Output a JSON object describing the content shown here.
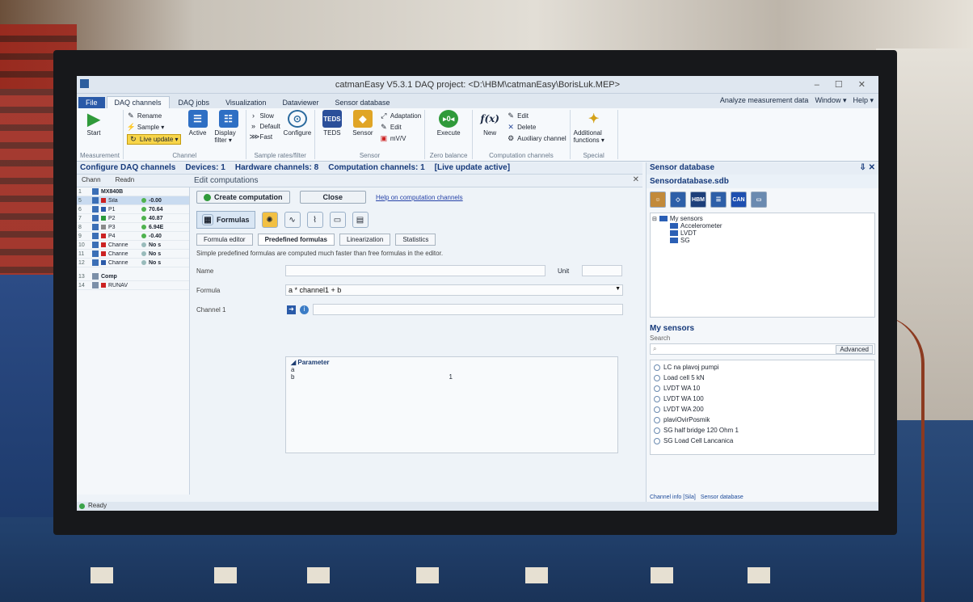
{
  "window": {
    "title": "catmanEasy V5.3.1 DAQ project: <D:\\HBM\\catmanEasy\\BorisLuk.MEP>",
    "controls": "– ☐ ✕"
  },
  "ribbon_tabs": [
    "File",
    "DAQ channels",
    "DAQ jobs",
    "Visualization",
    "Dataviewer",
    "Sensor database"
  ],
  "ribbon_right": {
    "analyze": "Analyze measurement data",
    "window": "Window ▾",
    "help": "Help ▾"
  },
  "ribbon": {
    "measurement": {
      "start": "Start",
      "label": "Measurement"
    },
    "channel": {
      "rename": "Rename",
      "sample": "Sample ▾",
      "live_update": "Live update ▾",
      "active": "Active",
      "display_filter": "Display filter ▾",
      "label": "Channel"
    },
    "sample_rates": {
      "slow": "Slow",
      "default": "Default",
      "fast": "Fast",
      "label": "Sample rates/filter"
    },
    "sensor": {
      "configure": "Configure",
      "teds": "TEDS",
      "sensor": "Sensor",
      "adaptation": "Adaptation",
      "edit": "Edit",
      "mvv": "mV/V",
      "label": "Sensor"
    },
    "zero": {
      "execute": "Execute",
      "label": "Zero balance"
    },
    "computation": {
      "new": "New",
      "edit": "Edit",
      "delete": "Delete",
      "auxiliary": "Auxiliary channel",
      "label": "Computation channels"
    },
    "special": {
      "additional": "Additional functions ▾",
      "label": "Special"
    }
  },
  "config_header": {
    "title": "Configure DAQ channels",
    "devices": "Devices: 1",
    "hardware": "Hardware channels: 8",
    "computation": "Computation channels: 1",
    "live": "[Live update active]"
  },
  "grid": {
    "headers": [
      "Chann",
      "Readn"
    ],
    "rows": [
      {
        "n": "1",
        "name": "MX840B",
        "val": ""
      },
      {
        "n": "5",
        "name": "Sila",
        "val": "-0.00"
      },
      {
        "n": "6",
        "name": "P1",
        "val": "70.64"
      },
      {
        "n": "7",
        "name": "P2",
        "val": "40.87"
      },
      {
        "n": "8",
        "name": "P3",
        "val": "6.94E"
      },
      {
        "n": "9",
        "name": "P4",
        "val": "-0.40"
      },
      {
        "n": "10",
        "name": "Channe",
        "val": "No s"
      },
      {
        "n": "11",
        "name": "Channe",
        "val": "No s"
      },
      {
        "n": "12",
        "name": "Channe",
        "val": "No s"
      },
      {
        "n": "13",
        "name": "Comp",
        "val": ""
      },
      {
        "n": "14",
        "name": "RUNAV",
        "val": ""
      }
    ]
  },
  "edit_computations": {
    "title": "Edit computations",
    "create_btn": "Create computation",
    "close_btn": "Close",
    "help_link": "Help on computation channels",
    "formulas_tab": "Formulas",
    "subtabs": [
      "Formula editor",
      "Predefined formulas",
      "Linearization",
      "Statistics"
    ],
    "hint": "Simple predefined formulas are computed much faster than free formulas in the editor.",
    "name_label": "Name",
    "unit_label": "Unit",
    "formula_label": "Formula",
    "formula_value": "a * channel1 + b",
    "channel1_label": "Channel 1",
    "param_header": "◢ Parameter",
    "params": [
      {
        "k": "a",
        "v": ""
      },
      {
        "k": "b",
        "v": "1"
      }
    ]
  },
  "sensor_db": {
    "title": "Sensor database",
    "pin": "⇩ ✕",
    "file": "Sensordatabase.sdb",
    "icons": [
      "user",
      "diamond",
      "HBM",
      "scale",
      "CAN",
      "pc"
    ],
    "tree": [
      "My sensors",
      "Accelerometer",
      "LVDT",
      "SG"
    ],
    "my_sensors": "My sensors",
    "search_label": "Search",
    "advanced": "Advanced",
    "list": [
      "LC na plavoj pumpi",
      "Load cell 5 kN",
      "LVDT WA 10",
      "LVDT WA 100",
      "LVDT WA 200",
      "plaviOvirPosmik",
      "SG half bridge 120 Ohm 1",
      "SG Load Cell Lancanica"
    ],
    "tabs": [
      "Channel info [Sila]",
      "Sensor database"
    ]
  },
  "status": {
    "text": "Ready"
  },
  "colors": {
    "accent": "#2a5aa8",
    "header_text": "#15397a",
    "live_highlight": "#f7d54a",
    "ok_green": "#4fb24f"
  }
}
